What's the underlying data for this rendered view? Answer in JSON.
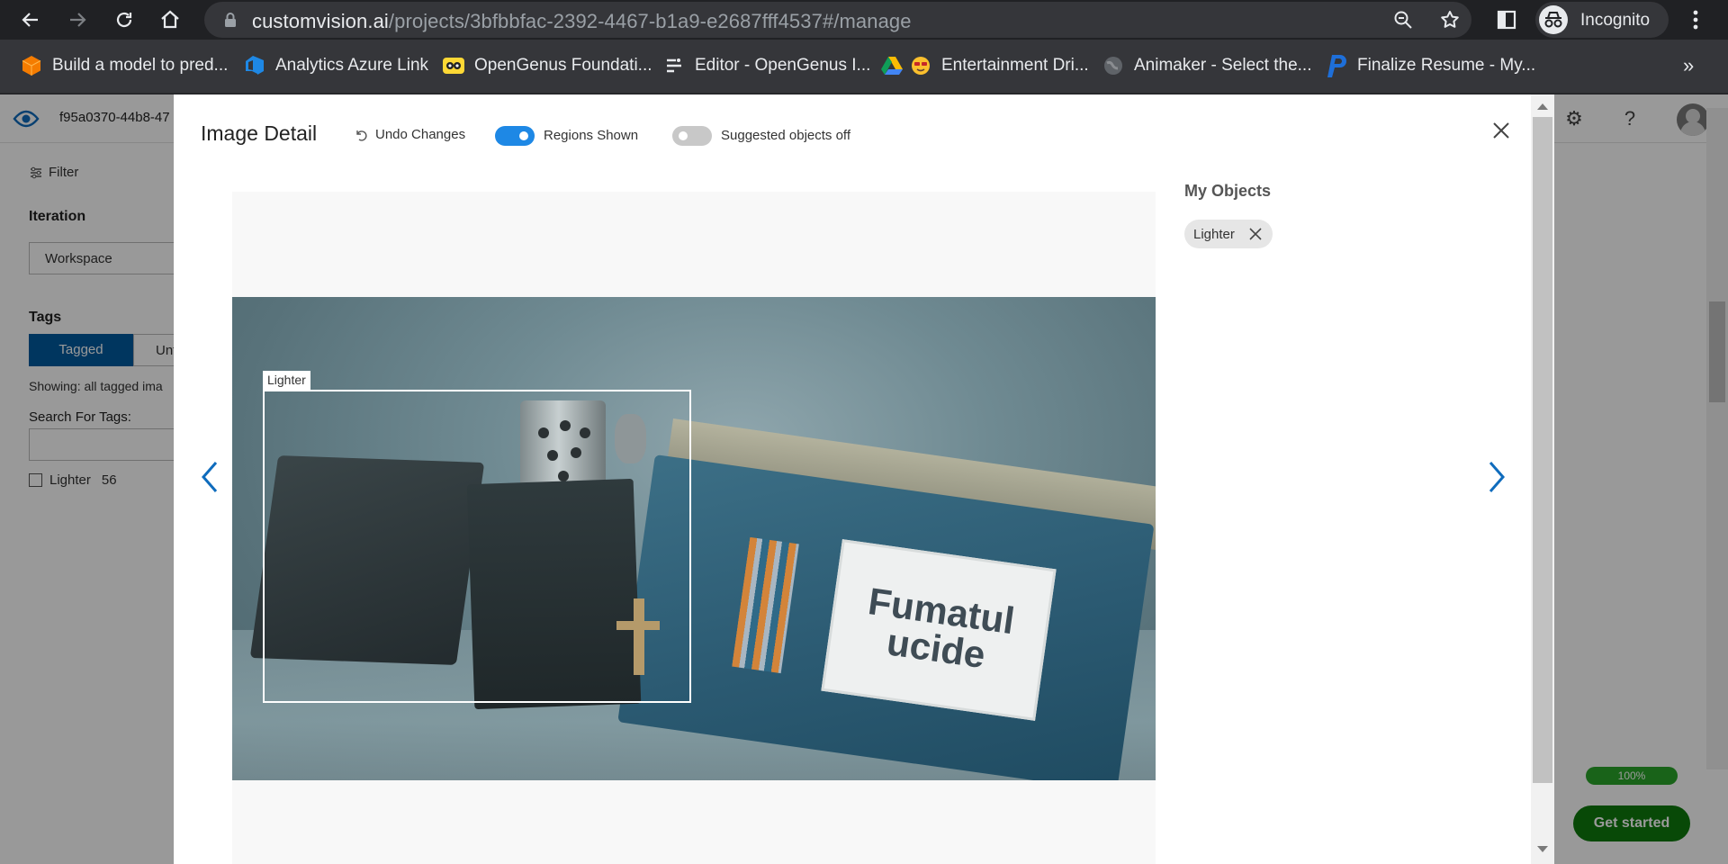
{
  "browser": {
    "url_host": "customvision.ai",
    "url_path": "/projects/3bfbbfac-2392-4467-b1a9-e2687fff4537#/manage",
    "profile_label": "Incognito",
    "bookmarks": [
      {
        "label": "Build a model to pred...",
        "icon": "orange-box-icon"
      },
      {
        "label": "Analytics Azure Link",
        "icon": "azure-devops-icon"
      },
      {
        "label": "OpenGenus Foundati...",
        "icon": "opengenus-icon"
      },
      {
        "label": "Editor - OpenGenus I...",
        "icon": "editor-icon"
      },
      {
        "label": "Entertainment Dri...",
        "icon": "google-drive-icon"
      },
      {
        "label": "Animaker - Select the...",
        "icon": "globe-icon"
      },
      {
        "label": "Finalize Resume - My...",
        "icon": "p-logo-icon"
      }
    ],
    "bookmarks_more": "»"
  },
  "background_page": {
    "project_id": "f95a0370-44b8-47",
    "filter_label": "Filter",
    "iteration_heading": "Iteration",
    "iteration_value": "Workspace",
    "tags_heading": "Tags",
    "tagged_label": "Tagged",
    "untagged_label": "Unt",
    "showing_text": "Showing: all tagged ima",
    "search_label": "Search For Tags:",
    "tag_item": {
      "label": "Lighter",
      "count": "56"
    },
    "progress_label": "100%",
    "get_started_label": "Get started"
  },
  "modal": {
    "title": "Image Detail",
    "undo_label": "Undo Changes",
    "regions_toggle": {
      "label": "Regions Shown",
      "on": true
    },
    "suggested_toggle": {
      "label": "Suggested objects off",
      "on": false
    },
    "region_tag": "Lighter",
    "objects_heading": "My Objects",
    "objects": [
      {
        "label": "Lighter"
      }
    ],
    "photo_text_line1": "Fumatul",
    "photo_text_line2": "ucide"
  },
  "colors": {
    "toggle_on": "#1e88e5",
    "toggle_off": "#c8c8c8",
    "tagged_bg": "#005a9e",
    "nav_arrow": "#0f6cbd"
  }
}
